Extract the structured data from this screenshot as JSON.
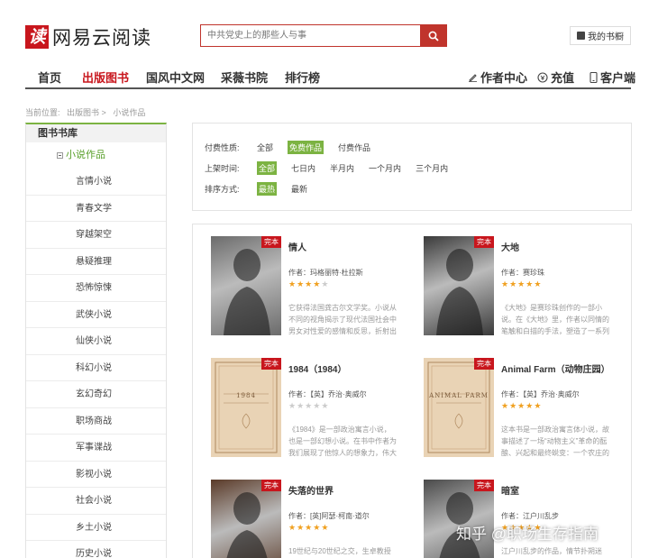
{
  "brand": {
    "mark": "读",
    "name": "网易云阅读"
  },
  "search": {
    "placeholder": "中共党史上的那些人与事"
  },
  "header": {
    "shelf_label": "我的书橱"
  },
  "nav": {
    "items": [
      "首页",
      "出版图书",
      "国风中文网",
      "采薇书院",
      "排行榜"
    ],
    "active": "出版图书",
    "right": [
      "作者中心",
      "充值",
      "客户端"
    ]
  },
  "breadcrumb": [
    "当前位置:",
    "出版图书 >",
    "小说作品"
  ],
  "sidebar": {
    "title": "图书书库",
    "subtitle": "小说作品",
    "items": [
      "言情小说",
      "青春文学",
      "穿越架空",
      "悬疑推理",
      "恐怖惊悚",
      "武侠小说",
      "仙侠小说",
      "科幻小说",
      "玄幻奇幻",
      "职场商战",
      "军事谍战",
      "影视小说",
      "社会小说",
      "乡土小说",
      "历史小说"
    ]
  },
  "filters": [
    {
      "label": "付费性质:",
      "options": [
        "全部",
        "免费作品",
        "付费作品"
      ],
      "selected": "免费作品"
    },
    {
      "label": "上架时间:",
      "options": [
        "全部",
        "七日内",
        "半月内",
        "一个月内",
        "三个月内"
      ],
      "selected": "全部"
    },
    {
      "label": "排序方式:",
      "options": [
        "最热",
        "最新"
      ],
      "selected": "最热"
    }
  ],
  "books": [
    {
      "title": "情人",
      "author": "作者：玛格丽特·杜拉斯",
      "rating": 4,
      "desc": "它获得法国龚古尔文学奖。小说从不同的视角揭示了现代法国社会中男女对性爱的感情和反思，折射出",
      "tag": "完本",
      "cover_color": "#6b6b6b"
    },
    {
      "title": "大地",
      "author": "作者：赛珍珠",
      "rating": 5,
      "desc": "《大地》是赛珍珠创作的一部小说。在《大地》里，作者以同情的笔触和白描的手法，塑造了一系列",
      "tag": "完本",
      "cover_color": "#3a3a3a"
    },
    {
      "title": "1984（1984）",
      "author": "作者：【英】乔治·奥威尔",
      "rating": 0,
      "desc": "《1984》是一部政治寓言小说，也是一部幻想小说。在书中作者为我们展现了他惊人的想象力，伟大",
      "tag": "完本",
      "cover_color": "#e9d3b5",
      "cover_text": "1984"
    },
    {
      "title": "Animal Farm（动物庄园）",
      "author": "作者：【英】乔治·奥威尔",
      "rating": 5,
      "desc": "这本书是一部政治寓言体小说，故事描述了一场“动物主义”革命的酝酿、兴起和最终蜕变：一个农庄的",
      "tag": "完本",
      "cover_color": "#e9d3b5",
      "cover_text": "ANIMAL FARM"
    },
    {
      "title": "失落的世界",
      "author": "作者：[英]阿瑟·柯南·道尔",
      "rating": 5,
      "desc": "19世纪与20世纪之交，生卓教授",
      "tag": "完本",
      "cover_color": "#5a3a28"
    },
    {
      "title": "暗室",
      "author": "作者：江户川乱步",
      "rating": 5,
      "desc": "江户川乱步的作品，情节扑朔迷",
      "tag": "完本",
      "cover_color": "#4a4a4a"
    }
  ],
  "watermark": "知乎 @职场生存指南",
  "colors": {
    "brand": "#c8161d",
    "accent": "#7cb342",
    "star": "#f0a020"
  }
}
